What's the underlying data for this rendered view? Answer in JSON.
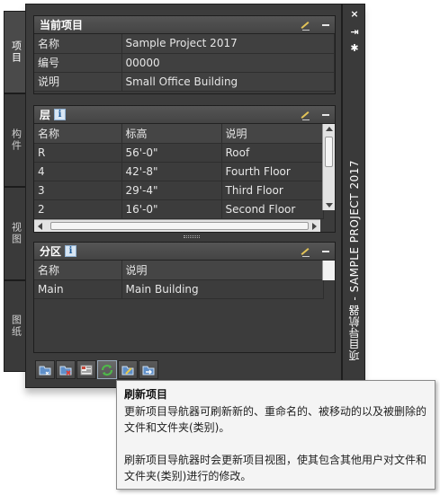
{
  "tabs": [
    {
      "label": "项目",
      "active": true
    },
    {
      "label": "构件",
      "active": false
    },
    {
      "label": "视图",
      "active": false
    },
    {
      "label": "图纸",
      "active": false
    }
  ],
  "current_project": {
    "title": "当前项目",
    "rows": [
      {
        "key": "名称",
        "value": "Sample Project 2017"
      },
      {
        "key": "编号",
        "value": "00000"
      },
      {
        "key": "说明",
        "value": "Small Office Building"
      }
    ]
  },
  "levels": {
    "title": "层",
    "columns": [
      "名称",
      "标高",
      "说明"
    ],
    "rows": [
      [
        "R",
        "56'-0\"",
        "Roof"
      ],
      [
        "4",
        "42'-8\"",
        "Fourth Floor"
      ],
      [
        "3",
        "29'-4\"",
        "Third Floor"
      ],
      [
        "2",
        "16'-0\"",
        "Second Floor"
      ]
    ]
  },
  "divisions": {
    "title": "分区",
    "columns": [
      "名称",
      "说明"
    ],
    "rows": [
      [
        "Main",
        "Main Building"
      ]
    ]
  },
  "toolbar": {
    "buttons": [
      "new-folder-icon",
      "delete-icon",
      "details-icon",
      "refresh-icon",
      "rename-icon",
      "move-icon"
    ]
  },
  "strip": {
    "title": "项目导航器 - SAMPLE PROJECT 2017",
    "close": "×",
    "autohide": "⇥",
    "settings": "✱"
  },
  "tooltip": {
    "title": "刷新项目",
    "line1": "更新项目导航器可刷新新的、重命名的、被移动的以及被删除的文件和文件夹(类别)。",
    "line2": "刷新项目导航器时会更新项目视图，使其包含其他用户对文件和文件夹(类别)进行的修改。"
  },
  "colors": {
    "panel": "#3c3c3c",
    "header": "#4a4a4a",
    "tooltip_bg": "#f4f4f4",
    "accent": "#3a7fc0"
  }
}
